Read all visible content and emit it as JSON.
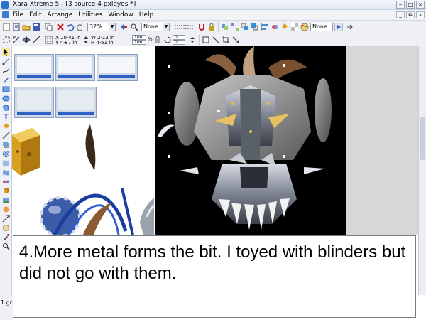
{
  "window": {
    "title": "Xara Xtreme 5 - [3 source 4 pxleyes *]"
  },
  "menu": {
    "items": [
      "File",
      "Edit",
      "Arrange",
      "Utilities",
      "Window",
      "Help"
    ]
  },
  "toolbar": {
    "zoom": "32%",
    "line_style": "None",
    "fill_style": "None"
  },
  "infobar": {
    "x": "X 10·41 in",
    "y": "Y 4·87 in",
    "w": "W 2·13 in",
    "h": "H 4·61 in",
    "scale_w": "100",
    "scale_h": "100",
    "pct": "%",
    "rot": "0",
    "skew": "0"
  },
  "caption": {
    "text": "4.More metal forms the bit. I toyed with blinders but did not go with them."
  },
  "status": {
    "text": "1 gr"
  },
  "colors": {
    "accent": "#2d62c4",
    "canvas_bg": "#000000",
    "panel_gray": "#d7d7d7"
  }
}
